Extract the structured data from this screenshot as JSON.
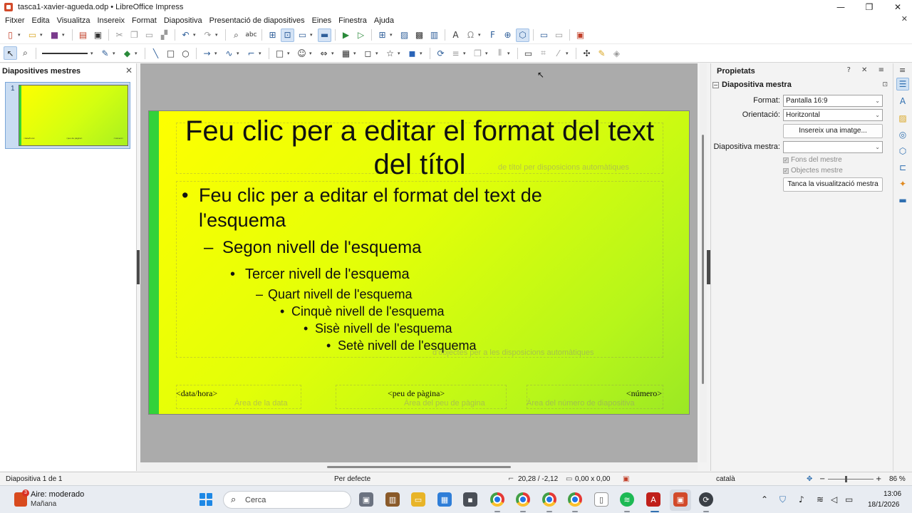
{
  "window": {
    "title": "tasca1-xavier-agueda.odp • LibreOffice Impress",
    "minimize": "—",
    "maximize": "❐",
    "close": "✕"
  },
  "menu": {
    "items": [
      "Fitxer",
      "Edita",
      "Visualitza",
      "Insereix",
      "Format",
      "Diapositiva",
      "Presentació de diapositives",
      "Eines",
      "Finestra",
      "Ajuda"
    ],
    "close_doc": "✕"
  },
  "left_pane": {
    "title": "Diapositives mestres",
    "close": "✕",
    "slide_number": "1"
  },
  "slide": {
    "title": "Feu clic per a editar el format del text del títol",
    "title_ghost": "de títol per disposicions automàtiques",
    "outline_ghost": "d'objectes per a les disposicions automàtiques",
    "levels": [
      "Feu clic per a editar el format del text de l'esquema",
      "Segon nivell de l'esquema",
      "Tercer nivell de l'esquema",
      "Quart nivell de l'esquema",
      "Cinquè nivell de l'esquema",
      "Sisè nivell de l'esquema",
      "Setè nivell de l'esquema"
    ],
    "bullets": [
      "•",
      "–",
      "•",
      "–",
      "•",
      "•",
      "•"
    ],
    "footer_date": "<data/hora>",
    "footer_center": "<peu de pàgina>",
    "footer_number": "<número>",
    "ghost_date": "Àrea de la data",
    "ghost_footer": "Àrea del peu de pàgina",
    "ghost_number": "Àrea del número de diapositiva",
    "colors": {
      "gradient_start": "#ffff00",
      "gradient_end": "#9be824",
      "left_bar": "#33d23a"
    }
  },
  "properties": {
    "title": "Propietats",
    "controls": "? ✕ ≡",
    "section": "Diapositiva mestra",
    "format_label": "Format:",
    "format_value": "Pantalla 16:9",
    "orientation_label": "Orientació:",
    "orientation_value": "Horitzontal",
    "insert_image": "Insereix una imatge...",
    "master_label": "Diapositiva mestra:",
    "master_value": "",
    "master_bg": "Fons del mestre",
    "master_objects": "Objectes mestre",
    "close_master": "Tanca la visualització mestra"
  },
  "status": {
    "slide": "Diapositiva 1 de 1",
    "layout": "Per defecte",
    "position": "20,28 / -2,12",
    "size": "0,00 x 0,00",
    "language": "català",
    "zoom": "86 %"
  },
  "taskbar": {
    "weather_badge": "3",
    "weather_title": "Aire: moderado",
    "weather_sub": "Mañana",
    "search": "Cerca",
    "time": "13:06",
    "date": "18/1/2026"
  }
}
